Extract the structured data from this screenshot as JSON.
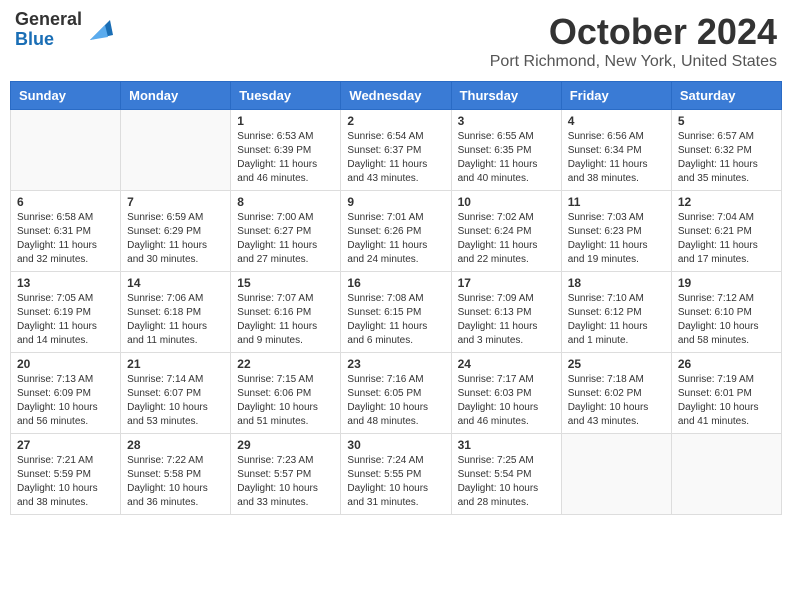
{
  "header": {
    "logo_general": "General",
    "logo_blue": "Blue",
    "month_title": "October 2024",
    "location": "Port Richmond, New York, United States"
  },
  "calendar": {
    "days_of_week": [
      "Sunday",
      "Monday",
      "Tuesday",
      "Wednesday",
      "Thursday",
      "Friday",
      "Saturday"
    ],
    "weeks": [
      [
        {
          "day": "",
          "info": ""
        },
        {
          "day": "",
          "info": ""
        },
        {
          "day": "1",
          "info": "Sunrise: 6:53 AM\nSunset: 6:39 PM\nDaylight: 11 hours and 46 minutes."
        },
        {
          "day": "2",
          "info": "Sunrise: 6:54 AM\nSunset: 6:37 PM\nDaylight: 11 hours and 43 minutes."
        },
        {
          "day": "3",
          "info": "Sunrise: 6:55 AM\nSunset: 6:35 PM\nDaylight: 11 hours and 40 minutes."
        },
        {
          "day": "4",
          "info": "Sunrise: 6:56 AM\nSunset: 6:34 PM\nDaylight: 11 hours and 38 minutes."
        },
        {
          "day": "5",
          "info": "Sunrise: 6:57 AM\nSunset: 6:32 PM\nDaylight: 11 hours and 35 minutes."
        }
      ],
      [
        {
          "day": "6",
          "info": "Sunrise: 6:58 AM\nSunset: 6:31 PM\nDaylight: 11 hours and 32 minutes."
        },
        {
          "day": "7",
          "info": "Sunrise: 6:59 AM\nSunset: 6:29 PM\nDaylight: 11 hours and 30 minutes."
        },
        {
          "day": "8",
          "info": "Sunrise: 7:00 AM\nSunset: 6:27 PM\nDaylight: 11 hours and 27 minutes."
        },
        {
          "day": "9",
          "info": "Sunrise: 7:01 AM\nSunset: 6:26 PM\nDaylight: 11 hours and 24 minutes."
        },
        {
          "day": "10",
          "info": "Sunrise: 7:02 AM\nSunset: 6:24 PM\nDaylight: 11 hours and 22 minutes."
        },
        {
          "day": "11",
          "info": "Sunrise: 7:03 AM\nSunset: 6:23 PM\nDaylight: 11 hours and 19 minutes."
        },
        {
          "day": "12",
          "info": "Sunrise: 7:04 AM\nSunset: 6:21 PM\nDaylight: 11 hours and 17 minutes."
        }
      ],
      [
        {
          "day": "13",
          "info": "Sunrise: 7:05 AM\nSunset: 6:19 PM\nDaylight: 11 hours and 14 minutes."
        },
        {
          "day": "14",
          "info": "Sunrise: 7:06 AM\nSunset: 6:18 PM\nDaylight: 11 hours and 11 minutes."
        },
        {
          "day": "15",
          "info": "Sunrise: 7:07 AM\nSunset: 6:16 PM\nDaylight: 11 hours and 9 minutes."
        },
        {
          "day": "16",
          "info": "Sunrise: 7:08 AM\nSunset: 6:15 PM\nDaylight: 11 hours and 6 minutes."
        },
        {
          "day": "17",
          "info": "Sunrise: 7:09 AM\nSunset: 6:13 PM\nDaylight: 11 hours and 3 minutes."
        },
        {
          "day": "18",
          "info": "Sunrise: 7:10 AM\nSunset: 6:12 PM\nDaylight: 11 hours and 1 minute."
        },
        {
          "day": "19",
          "info": "Sunrise: 7:12 AM\nSunset: 6:10 PM\nDaylight: 10 hours and 58 minutes."
        }
      ],
      [
        {
          "day": "20",
          "info": "Sunrise: 7:13 AM\nSunset: 6:09 PM\nDaylight: 10 hours and 56 minutes."
        },
        {
          "day": "21",
          "info": "Sunrise: 7:14 AM\nSunset: 6:07 PM\nDaylight: 10 hours and 53 minutes."
        },
        {
          "day": "22",
          "info": "Sunrise: 7:15 AM\nSunset: 6:06 PM\nDaylight: 10 hours and 51 minutes."
        },
        {
          "day": "23",
          "info": "Sunrise: 7:16 AM\nSunset: 6:05 PM\nDaylight: 10 hours and 48 minutes."
        },
        {
          "day": "24",
          "info": "Sunrise: 7:17 AM\nSunset: 6:03 PM\nDaylight: 10 hours and 46 minutes."
        },
        {
          "day": "25",
          "info": "Sunrise: 7:18 AM\nSunset: 6:02 PM\nDaylight: 10 hours and 43 minutes."
        },
        {
          "day": "26",
          "info": "Sunrise: 7:19 AM\nSunset: 6:01 PM\nDaylight: 10 hours and 41 minutes."
        }
      ],
      [
        {
          "day": "27",
          "info": "Sunrise: 7:21 AM\nSunset: 5:59 PM\nDaylight: 10 hours and 38 minutes."
        },
        {
          "day": "28",
          "info": "Sunrise: 7:22 AM\nSunset: 5:58 PM\nDaylight: 10 hours and 36 minutes."
        },
        {
          "day": "29",
          "info": "Sunrise: 7:23 AM\nSunset: 5:57 PM\nDaylight: 10 hours and 33 minutes."
        },
        {
          "day": "30",
          "info": "Sunrise: 7:24 AM\nSunset: 5:55 PM\nDaylight: 10 hours and 31 minutes."
        },
        {
          "day": "31",
          "info": "Sunrise: 7:25 AM\nSunset: 5:54 PM\nDaylight: 10 hours and 28 minutes."
        },
        {
          "day": "",
          "info": ""
        },
        {
          "day": "",
          "info": ""
        }
      ]
    ]
  }
}
